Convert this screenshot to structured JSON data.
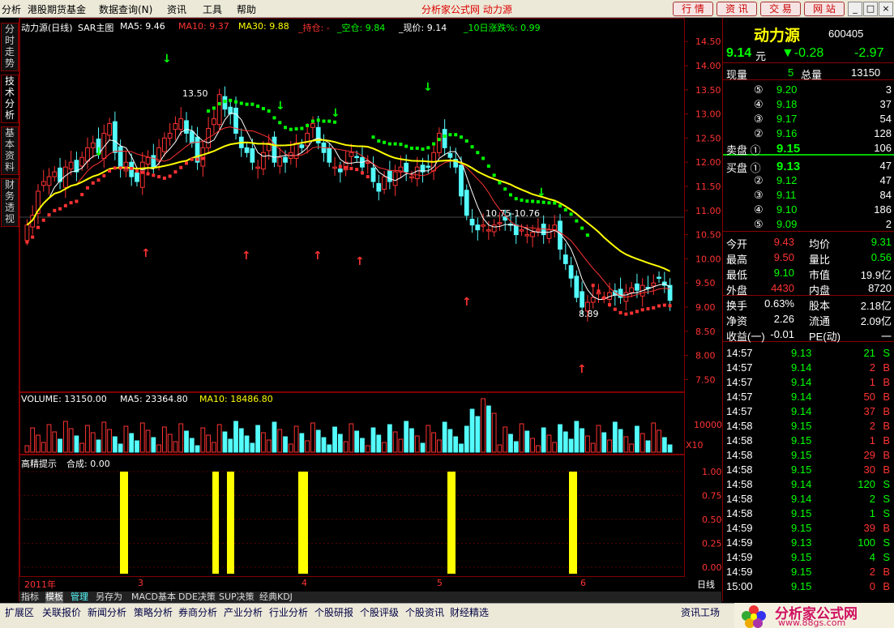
{
  "menu": [
    "分析",
    "港股期货基金",
    "数据查询(N)",
    "资讯",
    "工具",
    "帮助"
  ],
  "app_title": "分析家公式网  动力源",
  "top_buttons": [
    "行 情",
    "资 讯",
    "交 易",
    "网 站"
  ],
  "window_controls": [
    "_",
    "□",
    "×"
  ],
  "side_tabs": [
    "分时走势",
    "技术分析",
    "基本资料",
    "财务透视"
  ],
  "chart": {
    "header": {
      "name": "动力源(日线)",
      "main": "SAR主图",
      "ma5": "MA5: 9.46",
      "ma10": "MA10: 9.37",
      "ma30": "MA30: 9.88",
      "hold": "_持仓: -",
      "empty": "_空仓: 9.84",
      "price": "_现价: 9.14",
      "ten": "_10日涨跌%: 0.99"
    },
    "price_ticks": [
      "14.50",
      "14.00",
      "13.50",
      "13.00",
      "12.50",
      "12.00",
      "11.50",
      "11.00",
      "10.50",
      "10.00",
      "9.50",
      "9.00",
      "8.50",
      "8.00",
      "7.50"
    ],
    "annot_high": "13.50",
    "annot_low": "8.89",
    "annot_range": "10.75-10.76",
    "volume_header": {
      "vol": "VOLUME: 13150.00",
      "ma5": "MA5: 23364.80",
      "ma10": "MA10: 18486.80"
    },
    "volume_tick": "10000",
    "volume_unit": "X10",
    "ind_header": {
      "name": "高精提示",
      "value": "合成: 0.00"
    },
    "ind_ticks": [
      "1.00",
      "0.75",
      "0.50",
      "0.25",
      "0.00"
    ],
    "date_labels": [
      "2011年",
      "3",
      "4",
      "5",
      "6"
    ],
    "period": "日线"
  },
  "quote": {
    "name": "动力源",
    "code": "600405",
    "price": "9.14",
    "unit": "元",
    "change": "▼-0.28",
    "pct": "-2.97",
    "now_vol_label": "现量",
    "now_vol": "5",
    "total_vol_label": "总量",
    "total_vol": "13150",
    "sells": [
      {
        "l": "⑤",
        "p": "9.20",
        "v": "3"
      },
      {
        "l": "④",
        "p": "9.18",
        "v": "37"
      },
      {
        "l": "③",
        "p": "9.17",
        "v": "54"
      },
      {
        "l": "②",
        "p": "9.16",
        "v": "128"
      },
      {
        "l": "卖盘 ①",
        "p": "9.15",
        "v": "106"
      }
    ],
    "buys": [
      {
        "l": "买盘 ①",
        "p": "9.13",
        "v": "47"
      },
      {
        "l": "②",
        "p": "9.12",
        "v": "47"
      },
      {
        "l": "③",
        "p": "9.11",
        "v": "84"
      },
      {
        "l": "④",
        "p": "9.10",
        "v": "186"
      },
      {
        "l": "⑤",
        "p": "9.09",
        "v": "2"
      }
    ],
    "stats": [
      {
        "a": "今开",
        "b": "9.43",
        "c": "均价",
        "d": "9.31"
      },
      {
        "a": "最高",
        "b": "9.50",
        "c": "量比",
        "d": "0.56"
      },
      {
        "a": "最低",
        "b": "9.10",
        "c": "市值",
        "d": "19.9亿"
      },
      {
        "a": "外盘",
        "b": "4430",
        "c": "内盘",
        "d": "8720"
      },
      {
        "a": "换手",
        "b": "0.63%",
        "c": "股本",
        "d": "2.18亿"
      },
      {
        "a": "净资",
        "b": "2.26",
        "c": "流通",
        "d": "2.09亿"
      },
      {
        "a": "收益(一)",
        "b": "-0.01",
        "c": "PE(动)",
        "d": "一"
      }
    ],
    "ticks": [
      {
        "t": "14:57",
        "p": "9.13",
        "v": "21",
        "s": "S"
      },
      {
        "t": "14:57",
        "p": "9.14",
        "v": "2",
        "s": "B"
      },
      {
        "t": "14:57",
        "p": "9.14",
        "v": "1",
        "s": "B"
      },
      {
        "t": "14:57",
        "p": "9.14",
        "v": "50",
        "s": "B"
      },
      {
        "t": "14:57",
        "p": "9.14",
        "v": "37",
        "s": "B"
      },
      {
        "t": "14:58",
        "p": "9.15",
        "v": "2",
        "s": "B"
      },
      {
        "t": "14:58",
        "p": "9.15",
        "v": "1",
        "s": "B"
      },
      {
        "t": "14:58",
        "p": "9.15",
        "v": "29",
        "s": "B"
      },
      {
        "t": "14:58",
        "p": "9.15",
        "v": "30",
        "s": "B"
      },
      {
        "t": "14:58",
        "p": "9.14",
        "v": "120",
        "s": "S"
      },
      {
        "t": "14:58",
        "p": "9.14",
        "v": "2",
        "s": "S"
      },
      {
        "t": "14:58",
        "p": "9.15",
        "v": "1",
        "s": "S"
      },
      {
        "t": "14:59",
        "p": "9.15",
        "v": "39",
        "s": "B"
      },
      {
        "t": "14:59",
        "p": "9.13",
        "v": "100",
        "s": "S"
      },
      {
        "t": "14:59",
        "p": "9.15",
        "v": "4",
        "s": "S"
      },
      {
        "t": "14:59",
        "p": "9.15",
        "v": "2",
        "s": "B"
      },
      {
        "t": "15:00",
        "p": "9.15",
        "v": "0",
        "s": "B"
      }
    ]
  },
  "bottom_tabs": [
    "指标",
    "模板",
    "管理",
    "另存为",
    "MACD基本",
    "DDE决策",
    "SUP决策",
    "经典KDJ"
  ],
  "foot_tabs": [
    "扩展区",
    "关联报价",
    "新闻分析",
    "策略分析",
    "券商分析",
    "产业分析",
    "行业分析",
    "个股研报",
    "个股评级",
    "个股资讯",
    "财经精选",
    "资讯工场"
  ],
  "logo": {
    "text": "分析家公式网",
    "url": "www.88gs.com"
  },
  "colors": {
    "up": "#FF3232",
    "down": "#54FCFC",
    "ma5": "#FFFFFF",
    "ma10": "#FF3232",
    "ma30": "#FFFF00",
    "grid": "#800000",
    "green": "#00FF00",
    "yellow": "#FFFF00"
  }
}
